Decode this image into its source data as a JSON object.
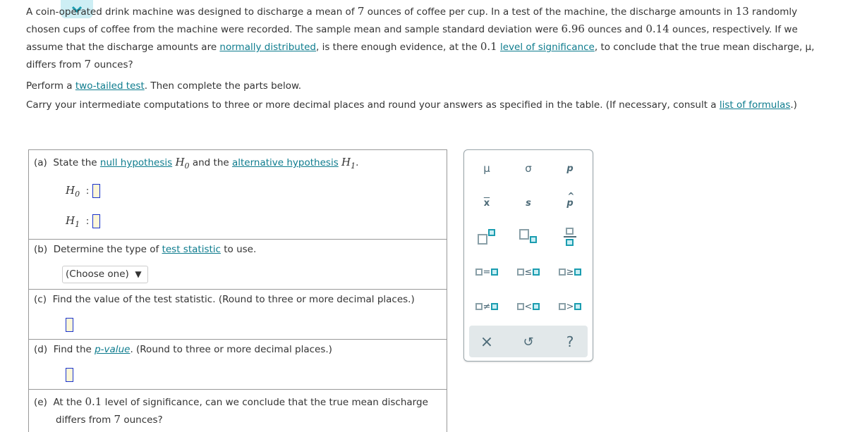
{
  "problem": {
    "p1_a": "A coin-operated drink machine was designed to discharge a mean of ",
    "mean_target": "7",
    "p1_b": " ounces of coffee per cup. In a test of the machine, the discharge amounts in ",
    "n": "13",
    "p1_c": " randomly chosen cups of coffee from the machine were recorded. The sample mean and sample standard deviation were ",
    "xbar": "6.96",
    "p1_d": " ounces and ",
    "s": "0.14",
    "p1_e": " ounces, respectively. If we assume that the discharge amounts are ",
    "link_normal": "normally distributed",
    "p1_f": ", is there enough evidence, at the ",
    "alpha": "0.1",
    "p1_g": " ",
    "link_level": "level of significance",
    "p1_h": ", to conclude that the true mean discharge, μ, differs from ",
    "p1_i": " ounces?",
    "p2_a": "Perform a ",
    "link_two_tailed": "two-tailed test",
    "p2_b": ". Then complete the parts below.",
    "p3_a": "Carry your intermediate computations to three or more decimal places and round your answers as specified in the table. (If necessary, consult a ",
    "link_formulas": "list of formulas",
    "p3_b": ".)"
  },
  "parts": {
    "a": {
      "label": "(a)",
      "t1": "State the ",
      "link1": "null hypothesis",
      "h0": "H",
      "t2": " and the ",
      "link2": "alternative hypothesis",
      "h1": "H",
      "t3": ".",
      "h0_sub": "0",
      "h1_sub": "1",
      "colon": ":"
    },
    "b": {
      "label": "(b)",
      "t1": "Determine the type of ",
      "link": "test statistic",
      "t2": " to use.",
      "select_value": "(Choose one)",
      "select_arrow": "▼"
    },
    "c": {
      "label": "(c)",
      "text": "Find the value of the test statistic. (Round to three or more decimal places.)"
    },
    "d": {
      "label": "(d)",
      "t1": "Find the ",
      "link": "p-value",
      "t2": ". (Round to three or more decimal places.)"
    },
    "e": {
      "label": "(e)",
      "t1": "At the ",
      "alpha": "0.1",
      "t2": " level of significance, can we conclude that the true mean discharge",
      "t3": "differs from ",
      "mean": "7",
      "t4": " ounces?"
    }
  },
  "palette": {
    "mu": "μ",
    "sigma": "σ",
    "p": "p",
    "xbar": "x",
    "s": "s",
    "phat": "p",
    "eq": "=",
    "le": "≤",
    "ge": "≥",
    "ne": "≠",
    "lt": "<",
    "gt": ">",
    "clear": "×",
    "undo": "↺",
    "help": "?"
  }
}
